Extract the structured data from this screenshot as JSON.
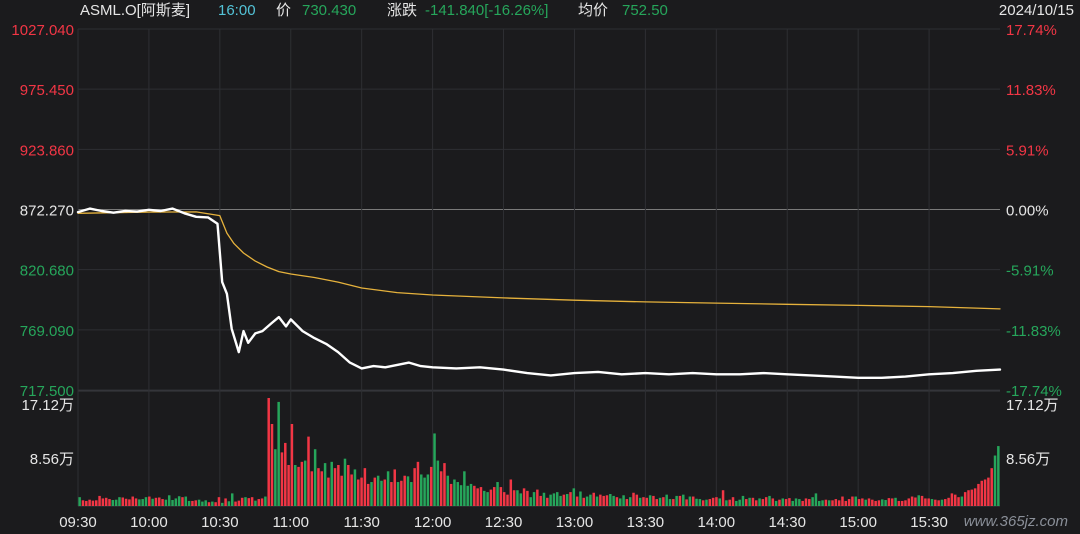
{
  "header": {
    "symbol": "ASML.O[阿斯麦]",
    "time": "16:00",
    "price_label": "价",
    "price": "730.430",
    "change_label": "涨跌",
    "change": "-141.840[-16.26%]",
    "avg_label": "均价",
    "avg": "752.50",
    "date": "2024/10/15"
  },
  "watermark": "www.365jz.com",
  "colors": {
    "background": "#1b1b1d",
    "up": "#f23645",
    "down": "#26a65b",
    "neutral": "#e6e6e6",
    "price_line": "#ffffff",
    "avg_line": "#e6b23c",
    "time_highlight": "#53c2d6"
  },
  "chart_data": [
    {
      "type": "line",
      "title": "",
      "ylim": [
        717.5,
        1027.04
      ],
      "reference": 872.27,
      "y_ticks_left": [
        "1027.040",
        "975.450",
        "923.860",
        "872.270",
        "820.680",
        "769.090",
        "717.500"
      ],
      "y_ticks_right": [
        "17.74%",
        "11.83%",
        "5.91%",
        "0.00%",
        "-5.91%",
        "-11.83%",
        "-17.74%"
      ],
      "x_ticks": [
        "09:30",
        "10:00",
        "10:30",
        "11:00",
        "11:30",
        "12:00",
        "12:30",
        "13:00",
        "13:30",
        "14:00",
        "14:30",
        "15:00",
        "15:30"
      ],
      "x_range": [
        "09:30",
        "16:00"
      ],
      "series": [
        {
          "key": "price",
          "x": [
            "09:30",
            "09:35",
            "09:40",
            "09:45",
            "09:50",
            "09:55",
            "10:00",
            "10:05",
            "10:10",
            "10:15",
            "10:20",
            "10:25",
            "10:29",
            "10:31",
            "10:33",
            "10:35",
            "10:38",
            "10:40",
            "10:42",
            "10:45",
            "10:48",
            "10:52",
            "10:55",
            "10:58",
            "11:00",
            "11:05",
            "11:10",
            "11:15",
            "11:20",
            "11:25",
            "11:30",
            "11:35",
            "11:40",
            "11:45",
            "11:50",
            "11:55",
            "12:00",
            "12:10",
            "12:20",
            "12:30",
            "12:40",
            "12:50",
            "13:00",
            "13:10",
            "13:20",
            "13:30",
            "13:40",
            "13:50",
            "14:00",
            "14:10",
            "14:20",
            "14:30",
            "14:40",
            "14:50",
            "15:00",
            "15:10",
            "15:20",
            "15:30",
            "15:40",
            "15:50",
            "16:00"
          ],
          "values": [
            870.0,
            873.0,
            871.0,
            869.5,
            871.0,
            870.5,
            872.0,
            871.0,
            873.0,
            869.0,
            866.0,
            865.5,
            860.0,
            810.0,
            800.0,
            770.0,
            750.0,
            768.0,
            758.0,
            766.0,
            768.0,
            775.0,
            780.0,
            772.0,
            778.0,
            768.0,
            762.0,
            757.0,
            750.0,
            741.0,
            736.0,
            738.0,
            737.0,
            739.0,
            741.0,
            738.0,
            737.0,
            736.0,
            737.0,
            735.0,
            732.0,
            730.0,
            732.0,
            733.0,
            731.0,
            732.0,
            731.0,
            732.0,
            731.0,
            731.0,
            732.0,
            731.0,
            730.0,
            729.0,
            728.0,
            728.0,
            729.0,
            731.0,
            732.0,
            734.0,
            735.0
          ]
        },
        {
          "key": "avg",
          "x": [
            "09:30",
            "10:00",
            "10:20",
            "10:30",
            "10:33",
            "10:36",
            "10:40",
            "10:45",
            "10:50",
            "10:55",
            "11:00",
            "11:10",
            "11:20",
            "11:30",
            "11:45",
            "12:00",
            "12:30",
            "13:00",
            "13:30",
            "14:00",
            "14:30",
            "15:00",
            "15:30",
            "16:00"
          ],
          "values": [
            869.0,
            870.0,
            870.2,
            867.0,
            852.0,
            843.0,
            835.0,
            828.0,
            823.0,
            819.0,
            817.0,
            814.0,
            810.0,
            805.0,
            801.0,
            799.0,
            796.5,
            794.5,
            793.0,
            792.0,
            791.0,
            790.0,
            789.0,
            787.0
          ]
        }
      ]
    },
    {
      "type": "bar",
      "title": "",
      "y_ticks": [
        "17.12万",
        "8.56万"
      ],
      "ylim": [
        0,
        171200
      ],
      "x_range": [
        "09:30",
        "16:00"
      ],
      "values": [
        14000,
        9000,
        8000,
        10000,
        8500,
        9000,
        16000,
        12000,
        13000,
        11000,
        9500,
        10000,
        14000,
        13500,
        11500,
        10500,
        15000,
        12000,
        10500,
        11000,
        14000,
        15000,
        11500,
        13000,
        13500,
        11000,
        10000,
        17000,
        9500,
        12000,
        15500,
        14000,
        15000,
        8000,
        8000,
        9000,
        10000,
        7000,
        9000,
        6000,
        7000,
        6000,
        14000,
        5000,
        12000,
        7500,
        20000,
        7000,
        8500,
        13000,
        14000,
        12500,
        14000,
        8500,
        11000,
        12000,
        15000,
        171200,
        130000,
        90000,
        165000,
        85000,
        100000,
        65000,
        130000,
        65000,
        62000,
        70000,
        72000,
        110000,
        55000,
        90000,
        60000,
        55000,
        68000,
        45000,
        70000,
        60000,
        65000,
        48000,
        75000,
        65000,
        50000,
        58000,
        42000,
        45000,
        60000,
        35000,
        38000,
        45000,
        48000,
        40000,
        42000,
        55000,
        38000,
        58000,
        38000,
        40000,
        48000,
        47000,
        38000,
        60000,
        70000,
        50000,
        45000,
        50000,
        62000,
        115000,
        72000,
        55000,
        68000,
        48000,
        35000,
        42000,
        38000,
        33000,
        55000,
        32000,
        35000,
        32000,
        28000,
        30000,
        24000,
        22000,
        26000,
        30000,
        38000,
        30000,
        22000,
        18000,
        42000,
        25000,
        25000,
        20000,
        28000,
        24000,
        14000,
        22000,
        26000,
        16000,
        21000,
        13000,
        18000,
        20000,
        22000,
        16000,
        18000,
        19000,
        22000,
        28000,
        15000,
        23000,
        13000,
        15000,
        18000,
        21000,
        15000,
        18000,
        16000,
        17000,
        19000,
        16000,
        14000,
        12000,
        17000,
        11000,
        14000,
        21000,
        18000,
        13000,
        14000,
        13000,
        17000,
        16000,
        11000,
        13000,
        14000,
        18000,
        11000,
        11000,
        16000,
        16000,
        18000,
        10500,
        15000,
        15000,
        11500,
        11000,
        9000,
        10000,
        11000,
        13000,
        14000,
        12000,
        25000,
        9000,
        10000,
        14000,
        8000,
        10000,
        16000,
        11000,
        13000,
        13000,
        9000,
        12000,
        11000,
        14000,
        16000,
        12000,
        8000,
        10000,
        12000,
        11000,
        12500,
        8000,
        12000,
        11000,
        8000,
        12000,
        11000,
        14000,
        20000,
        8000,
        9000,
        10000,
        9000,
        9000,
        11000,
        9000,
        15000,
        8000,
        11000,
        15000,
        15000,
        11000,
        12000,
        10000,
        12000,
        10000,
        8000,
        9000,
        10500,
        9500,
        12500,
        12000,
        13000,
        8000,
        8000,
        9000,
        12000,
        15000,
        13500,
        17000,
        16000,
        12000,
        12000,
        11000,
        10000,
        9000,
        10000,
        11000,
        13000,
        20000,
        18000,
        14000,
        15000,
        22000,
        25000,
        26000,
        28000,
        35000,
        40000,
        42000,
        45000,
        60000,
        80000,
        95000
      ],
      "directions": [
        -1,
        1,
        1,
        1,
        1,
        1,
        1,
        1,
        1,
        1,
        -1,
        -1,
        -1,
        1,
        1,
        1,
        1,
        1,
        -1,
        -1,
        -1,
        1,
        -1,
        1,
        1,
        1,
        -1,
        -1,
        -1,
        -1,
        -1,
        1,
        -1,
        -1,
        1,
        1,
        -1,
        -1,
        -1,
        1,
        -1,
        1,
        1,
        -1,
        1,
        -1,
        -1,
        1,
        1,
        1,
        -1,
        1,
        1,
        -1,
        1,
        1,
        -1,
        1,
        1,
        -1,
        -1,
        1,
        1,
        1,
        1,
        -1,
        1,
        1,
        -1,
        1,
        1,
        -1,
        1,
        1,
        -1,
        1,
        -1,
        1,
        1,
        1,
        -1,
        1,
        1,
        -1,
        1,
        1,
        1,
        1,
        -1,
        1,
        -1,
        -1,
        1,
        -1,
        1,
        1,
        -1,
        1,
        1,
        -1,
        -1,
        1,
        1,
        -1,
        -1,
        -1,
        1,
        -1,
        -1,
        1,
        1,
        -1,
        1,
        -1,
        -1,
        -1,
        -1,
        -1,
        -1,
        1,
        1,
        1,
        -1,
        -1,
        1,
        1,
        -1,
        1,
        1,
        1,
        1,
        1,
        -1,
        -1,
        1,
        1,
        -1,
        -1,
        1,
        1,
        -1,
        1,
        -1,
        -1,
        -1,
        -1,
        1,
        -1,
        1,
        -1,
        1,
        -1,
        1,
        -1,
        -1,
        1,
        -1,
        1,
        1,
        1,
        -1,
        -1,
        1,
        -1,
        -1,
        1,
        -1,
        1,
        1,
        -1,
        1,
        1,
        -1,
        1,
        1,
        -1,
        1,
        -1,
        -1,
        1,
        -1,
        1,
        -1,
        1,
        -1,
        1,
        -1,
        -1,
        1,
        -1,
        1,
        1,
        1,
        -1,
        1,
        -1,
        1,
        1,
        -1,
        -1,
        -1,
        1,
        -1,
        1,
        1,
        -1,
        1,
        1,
        -1,
        1,
        -1,
        1,
        -1,
        1,
        1,
        -1,
        -1,
        -1,
        1,
        1,
        1,
        -1,
        -1,
        -1,
        -1,
        1,
        -1,
        1,
        1,
        1,
        1,
        1,
        1,
        1,
        -1,
        1,
        1,
        -1,
        1,
        1,
        1,
        1,
        -1,
        -1,
        1,
        1,
        -1,
        1,
        1,
        1,
        1,
        1,
        1,
        -1,
        1,
        1,
        1,
        -1,
        1,
        1,
        -1,
        1,
        1,
        1,
        1,
        1,
        -1,
        1,
        1,
        1,
        1,
        1,
        1,
        1,
        1,
        1
      ]
    }
  ]
}
